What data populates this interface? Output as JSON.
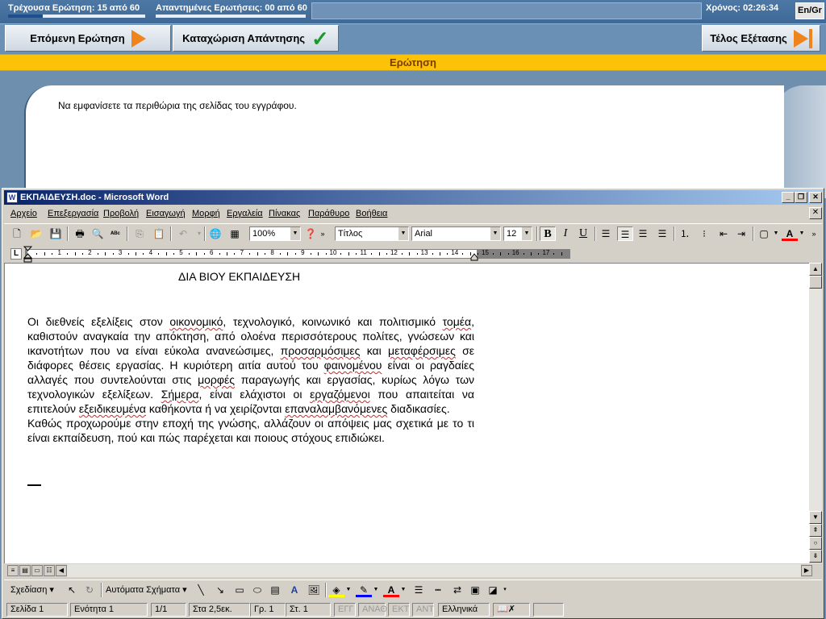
{
  "exam": {
    "current_question": "Τρέχουσα Ερώτηση: 15 από 60",
    "current_progress": 0.25,
    "answered_questions": "Απαντημένες Ερωτήσεις: 00 από 60",
    "answered_progress": 0,
    "timer": "Χρόνος: 02:26:34",
    "lang_button": "En/Gr",
    "next_button": "Επόμενη Ερώτηση",
    "submit_button": "Καταχώριση Απάντησης",
    "end_button": "Τέλος Εξέτασης",
    "question_header": "Ερώτηση",
    "question_text": "Να εμφανίσετε τα περιθώρια της σελίδας του εγγράφου."
  },
  "word": {
    "title": "ΕΚΠΑΙΔΕΥΣΗ.doc - Microsoft Word",
    "menu": [
      "Αρχείο",
      "Επεξεργασία",
      "Προβολή",
      "Εισαγωγή",
      "Μορφή",
      "Εργαλεία",
      "Πίνακας",
      "Παράθυρο",
      "Βοήθεια"
    ],
    "toolbar": {
      "zoom": "100%",
      "style": "Τίτλος",
      "font": "Arial",
      "size": "12",
      "bold_label": "B",
      "italic_label": "I",
      "underline_label": "U"
    },
    "ruler_numbers": [
      "1",
      "2",
      "3",
      "4",
      "5",
      "6",
      "7",
      "8",
      "9",
      "10",
      "11",
      "12",
      "13",
      "14",
      "15",
      "16",
      "17"
    ],
    "document": {
      "title": "ΔΙΑ ΒΙΟΥ ΕΚΠΑΙΔΕΥΣΗ",
      "paragraph1_parts": [
        "Οι διεθνείς εξελίξεις στον ",
        "οικονομικό",
        ", τεχνολογικό, κοινωνικό και πολιτισμικό ",
        "τομέα",
        ", καθιστούν αναγκαία την απόκτηση, από ολοένα περισσότερους πολίτες, γνώσεων και ικανοτήτων που να  είναι εύκολα ανανεώσιμες, ",
        "προσαρμόσιμες",
        " και ",
        "μεταφέρσιμες",
        " σε διάφορες θέσεις εργασίας. Η κυριότερη αιτία αυτού του ",
        "φαινομένου",
        " είναι οι ραγδαίες αλλαγές που συντελούνται στις ",
        "μορφές",
        " παραγωγής και εργασίας, κυρίως λόγω των τεχνολογικών εξελίξεων. ",
        "Σήμερα",
        ", είναι ελάχιστοι οι ",
        "εργαζόμενοι",
        " που απαιτείται να επιτελούν ",
        "εξειδικευμένα",
        " καθήκοντα ή να χειρίζονται ",
        "επαναλαμβανόμενες",
        " διαδικασίες."
      ],
      "paragraph2": "Καθώς προχωρούμε στην εποχή της γνώσης, αλλάζουν οι απόψεις μας σχετικά με το τι είναι εκπαίδευση, πού και πώς παρέχεται και ποιους στόχους επιδιώκει."
    },
    "drawbar": {
      "draw": "Σχεδίαση",
      "autoshapes": "Αυτόματα Σχήματα"
    },
    "status": {
      "page": "Σελίδα  1",
      "section": "Ενότητα  1",
      "pages": "1/1",
      "at": "Στα 2,5εκ.",
      "line": "Γρ.  1",
      "col": "Στ.  1",
      "rec": "ΕΓΓ",
      "trk": "ΑΝΑΘ",
      "ext": "ΕΚΤ",
      "ovr": "ΑΝΤ",
      "language": "Ελληνικά"
    },
    "colors": {
      "highlight": "#ffff00",
      "line": "#0000ff",
      "font": "#ff0000",
      "title_start": "#0a246a",
      "title_end": "#a6caf0"
    }
  }
}
